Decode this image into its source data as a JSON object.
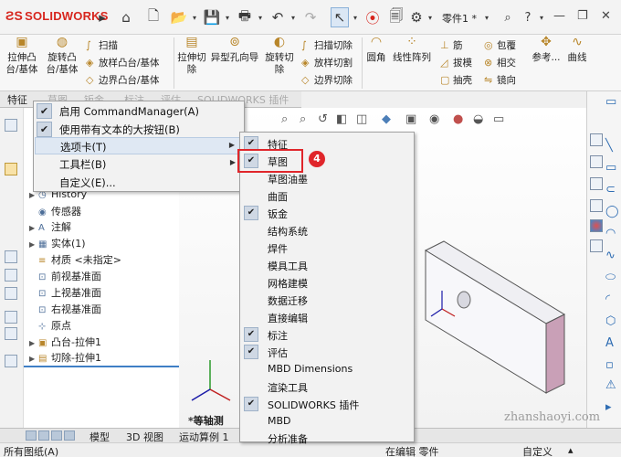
{
  "app": {
    "logo_text": "SOLIDWORKS",
    "part_label": "零件1 *"
  },
  "ribbon": {
    "extrude_boss": "拉伸凸\n台/基体",
    "revolve_boss": "旋转凸\n台/基体",
    "sweep": "扫描",
    "loft_boss": "放样凸台/基体",
    "boundary_boss": "边界凸台/基体",
    "extrude_cut": "拉伸切\n除",
    "hole_wizard": "异型孔向导",
    "revolve_cut": "旋转切\n除",
    "sweep_cut": "扫描切除",
    "loft_cut": "放样切割",
    "boundary_cut": "边界切除",
    "fillet": "圆角",
    "linear_pattern": "线性阵列",
    "rib": "筋",
    "draft": "拔模",
    "shell": "抽壳",
    "wrap": "包覆",
    "intersect": "相交",
    "mirror": "镜向",
    "reference": "参考...",
    "curves": "曲线"
  },
  "tabs": [
    "特征",
    "草图",
    "钣金",
    "标注",
    "评估",
    "SOLIDWORKS 插件"
  ],
  "tree": {
    "items": [
      {
        "label": "History",
        "expand": "▶"
      },
      {
        "label": "传感器",
        "expand": ""
      },
      {
        "label": "注解",
        "expand": "▶"
      },
      {
        "label": "实体(1)",
        "expand": "▶"
      },
      {
        "label": "材质 <未指定>",
        "expand": ""
      },
      {
        "label": "前视基准面",
        "expand": ""
      },
      {
        "label": "上视基准面",
        "expand": ""
      },
      {
        "label": "右视基准面",
        "expand": ""
      },
      {
        "label": "原点",
        "expand": ""
      },
      {
        "label": "凸台-拉伸1",
        "expand": "▶"
      },
      {
        "label": "切除-拉伸1",
        "expand": "▶"
      }
    ]
  },
  "viewport": {
    "view_label": "*等轴测"
  },
  "menu1": {
    "items": [
      {
        "label": "启用 CommandManager(A)",
        "checked": true,
        "submenu": false
      },
      {
        "label": "使用带有文本的大按钮(B)",
        "checked": true,
        "submenu": false
      },
      {
        "label": "选项卡(T)",
        "checked": false,
        "submenu": true
      },
      {
        "label": "工具栏(B)",
        "checked": false,
        "submenu": true
      },
      {
        "label": "自定义(E)...",
        "checked": false,
        "submenu": false
      }
    ]
  },
  "menu2": {
    "items": [
      {
        "label": "特征",
        "checked": true
      },
      {
        "label": "草图",
        "checked": true
      },
      {
        "label": "草图油墨",
        "checked": false
      },
      {
        "label": "曲面",
        "checked": false
      },
      {
        "label": "钣金",
        "checked": true
      },
      {
        "label": "结构系统",
        "checked": false
      },
      {
        "label": "焊件",
        "checked": false
      },
      {
        "label": "模具工具",
        "checked": false
      },
      {
        "label": "网格建模",
        "checked": false
      },
      {
        "label": "数据迁移",
        "checked": false
      },
      {
        "label": "直接编辑",
        "checked": false
      },
      {
        "label": "标注",
        "checked": true
      },
      {
        "label": "评估",
        "checked": true
      },
      {
        "label": "MBD Dimensions",
        "checked": false
      },
      {
        "label": "渲染工具",
        "checked": false
      },
      {
        "label": "SOLIDWORKS 插件",
        "checked": true
      },
      {
        "label": "MBD",
        "checked": false
      },
      {
        "label": "分析准备",
        "checked": false
      }
    ],
    "step_badge": "4"
  },
  "bottom_tabs": [
    "模型",
    "3D 视图",
    "运动算例 1"
  ],
  "status": {
    "left": "所有图纸(A)",
    "middle": "在编辑 零件",
    "right": "自定义"
  },
  "watermark": "zhanshaoyi.com",
  "colors": {
    "accent": "#2f6db3",
    "highlight": "#e0262b",
    "logo": "#d7261e"
  }
}
